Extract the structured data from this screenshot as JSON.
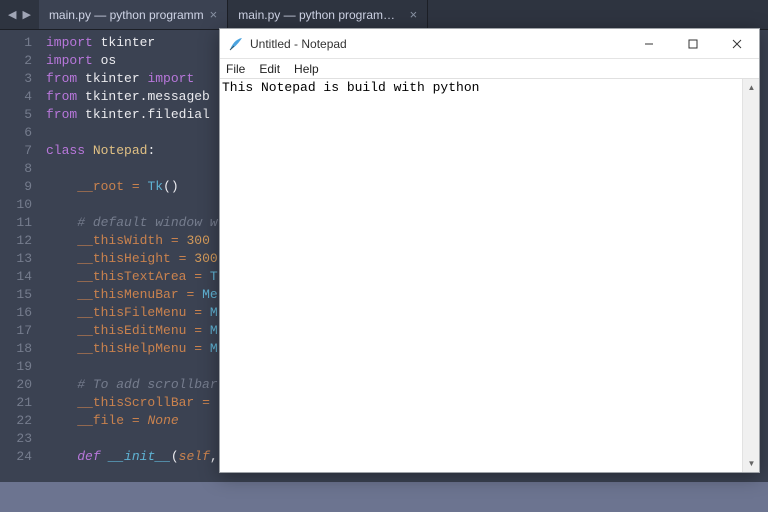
{
  "tabs": [
    {
      "label": "main.py — python programm",
      "active": true
    },
    {
      "label": "main.py — python programm\\MarioPygame-@codehub\\Next",
      "active": false
    }
  ],
  "gutter_lines": [
    "1",
    "2",
    "3",
    "4",
    "5",
    "6",
    "7",
    "8",
    "9",
    "10",
    "11",
    "12",
    "13",
    "14",
    "15",
    "16",
    "17",
    "18",
    "19",
    "20",
    "21",
    "22",
    "23",
    "24"
  ],
  "code": {
    "l1": {
      "kw": "import",
      "mod": "tkinter"
    },
    "l2": {
      "kw": "import",
      "mod": "os"
    },
    "l3": {
      "kw1": "from",
      "mod": "tkinter",
      "kw2": "import",
      "rest": ""
    },
    "l4": {
      "kw1": "from",
      "mod": "tkinter.messageb"
    },
    "l5": {
      "kw1": "from",
      "mod": "tkinter.filedial"
    },
    "l7": {
      "kw": "class",
      "name": "Notepad",
      "colon": ":"
    },
    "l9": {
      "attr": "__root",
      "op": "=",
      "fn": "Tk",
      "paren": "()"
    },
    "l11": {
      "comment": "# default window w"
    },
    "l12": {
      "attr": "__thisWidth",
      "op": "=",
      "num": "300"
    },
    "l13": {
      "attr": "__thisHeight",
      "op": "=",
      "num": "300"
    },
    "l14": {
      "attr": "__thisTextArea",
      "op": "=",
      "rest": "T"
    },
    "l15": {
      "attr": "__thisMenuBar",
      "op": "=",
      "rest": "Me"
    },
    "l16": {
      "attr": "__thisFileMenu",
      "op": "=",
      "rest": "M"
    },
    "l17": {
      "attr": "__thisEditMenu",
      "op": "=",
      "rest": "M"
    },
    "l18": {
      "attr": "__thisHelpMenu",
      "op": "=",
      "rest": "M"
    },
    "l20": {
      "comment": "# To add scrollbar"
    },
    "l21": {
      "attr": "__thisScrollBar",
      "op": "="
    },
    "l22": {
      "attr": "__file",
      "op": "=",
      "none": "None"
    },
    "l24": {
      "def": "def",
      "name": "__init__",
      "paren_open": "(",
      "param": "self",
      "rest": ","
    }
  },
  "notepad": {
    "title": "Untitled - Notepad",
    "menu": {
      "file": "File",
      "edit": "Edit",
      "help": "Help"
    },
    "text": "This Notepad is build with python"
  }
}
